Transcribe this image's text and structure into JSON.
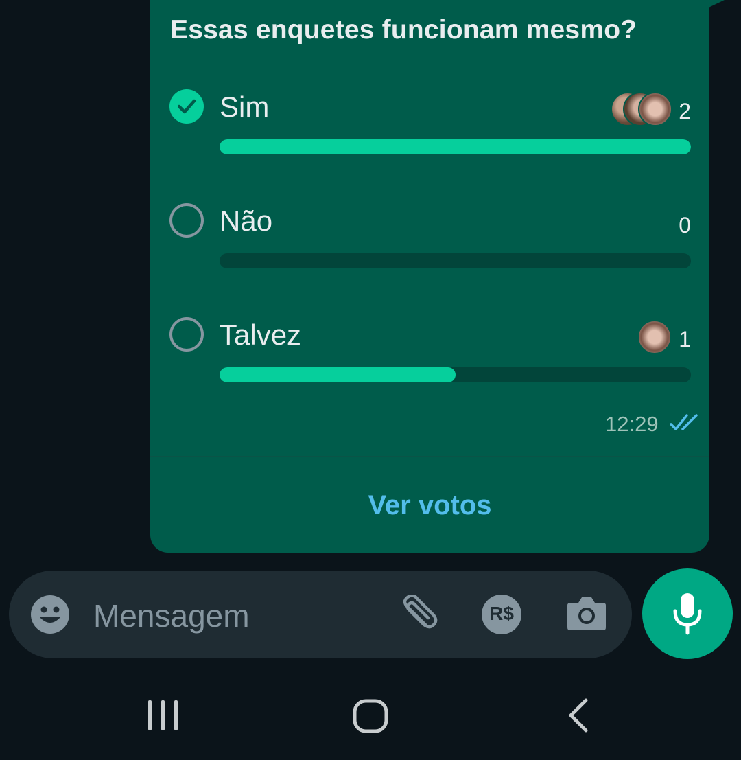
{
  "poll": {
    "question": "Essas enquetes funcionam mesmo?",
    "options": [
      {
        "label": "Sim",
        "votes": "2",
        "selected": true,
        "fill_fraction": 1.0
      },
      {
        "label": "Não",
        "votes": "0",
        "selected": false,
        "fill_fraction": 0.0
      },
      {
        "label": "Talvez",
        "votes": "1",
        "selected": false,
        "fill_fraction": 0.5
      }
    ],
    "time": "12:29",
    "read_status": "double-check-icon",
    "view_votes_label": "Ver votos"
  },
  "composer": {
    "placeholder": "Mensagem",
    "icons": [
      "emoji-icon",
      "attach-icon",
      "payment-icon",
      "camera-icon",
      "mic-icon"
    ],
    "payment_label": "R$"
  },
  "navigation": {
    "icons": [
      "recent-apps-icon",
      "home-icon",
      "back-icon"
    ]
  },
  "colors": {
    "background": "#0b141a",
    "bubble": "#005c4b",
    "accent": "#06cf9c",
    "link": "#53bdeb",
    "input_bg": "#1f2c33",
    "mic_button": "#00a884"
  }
}
